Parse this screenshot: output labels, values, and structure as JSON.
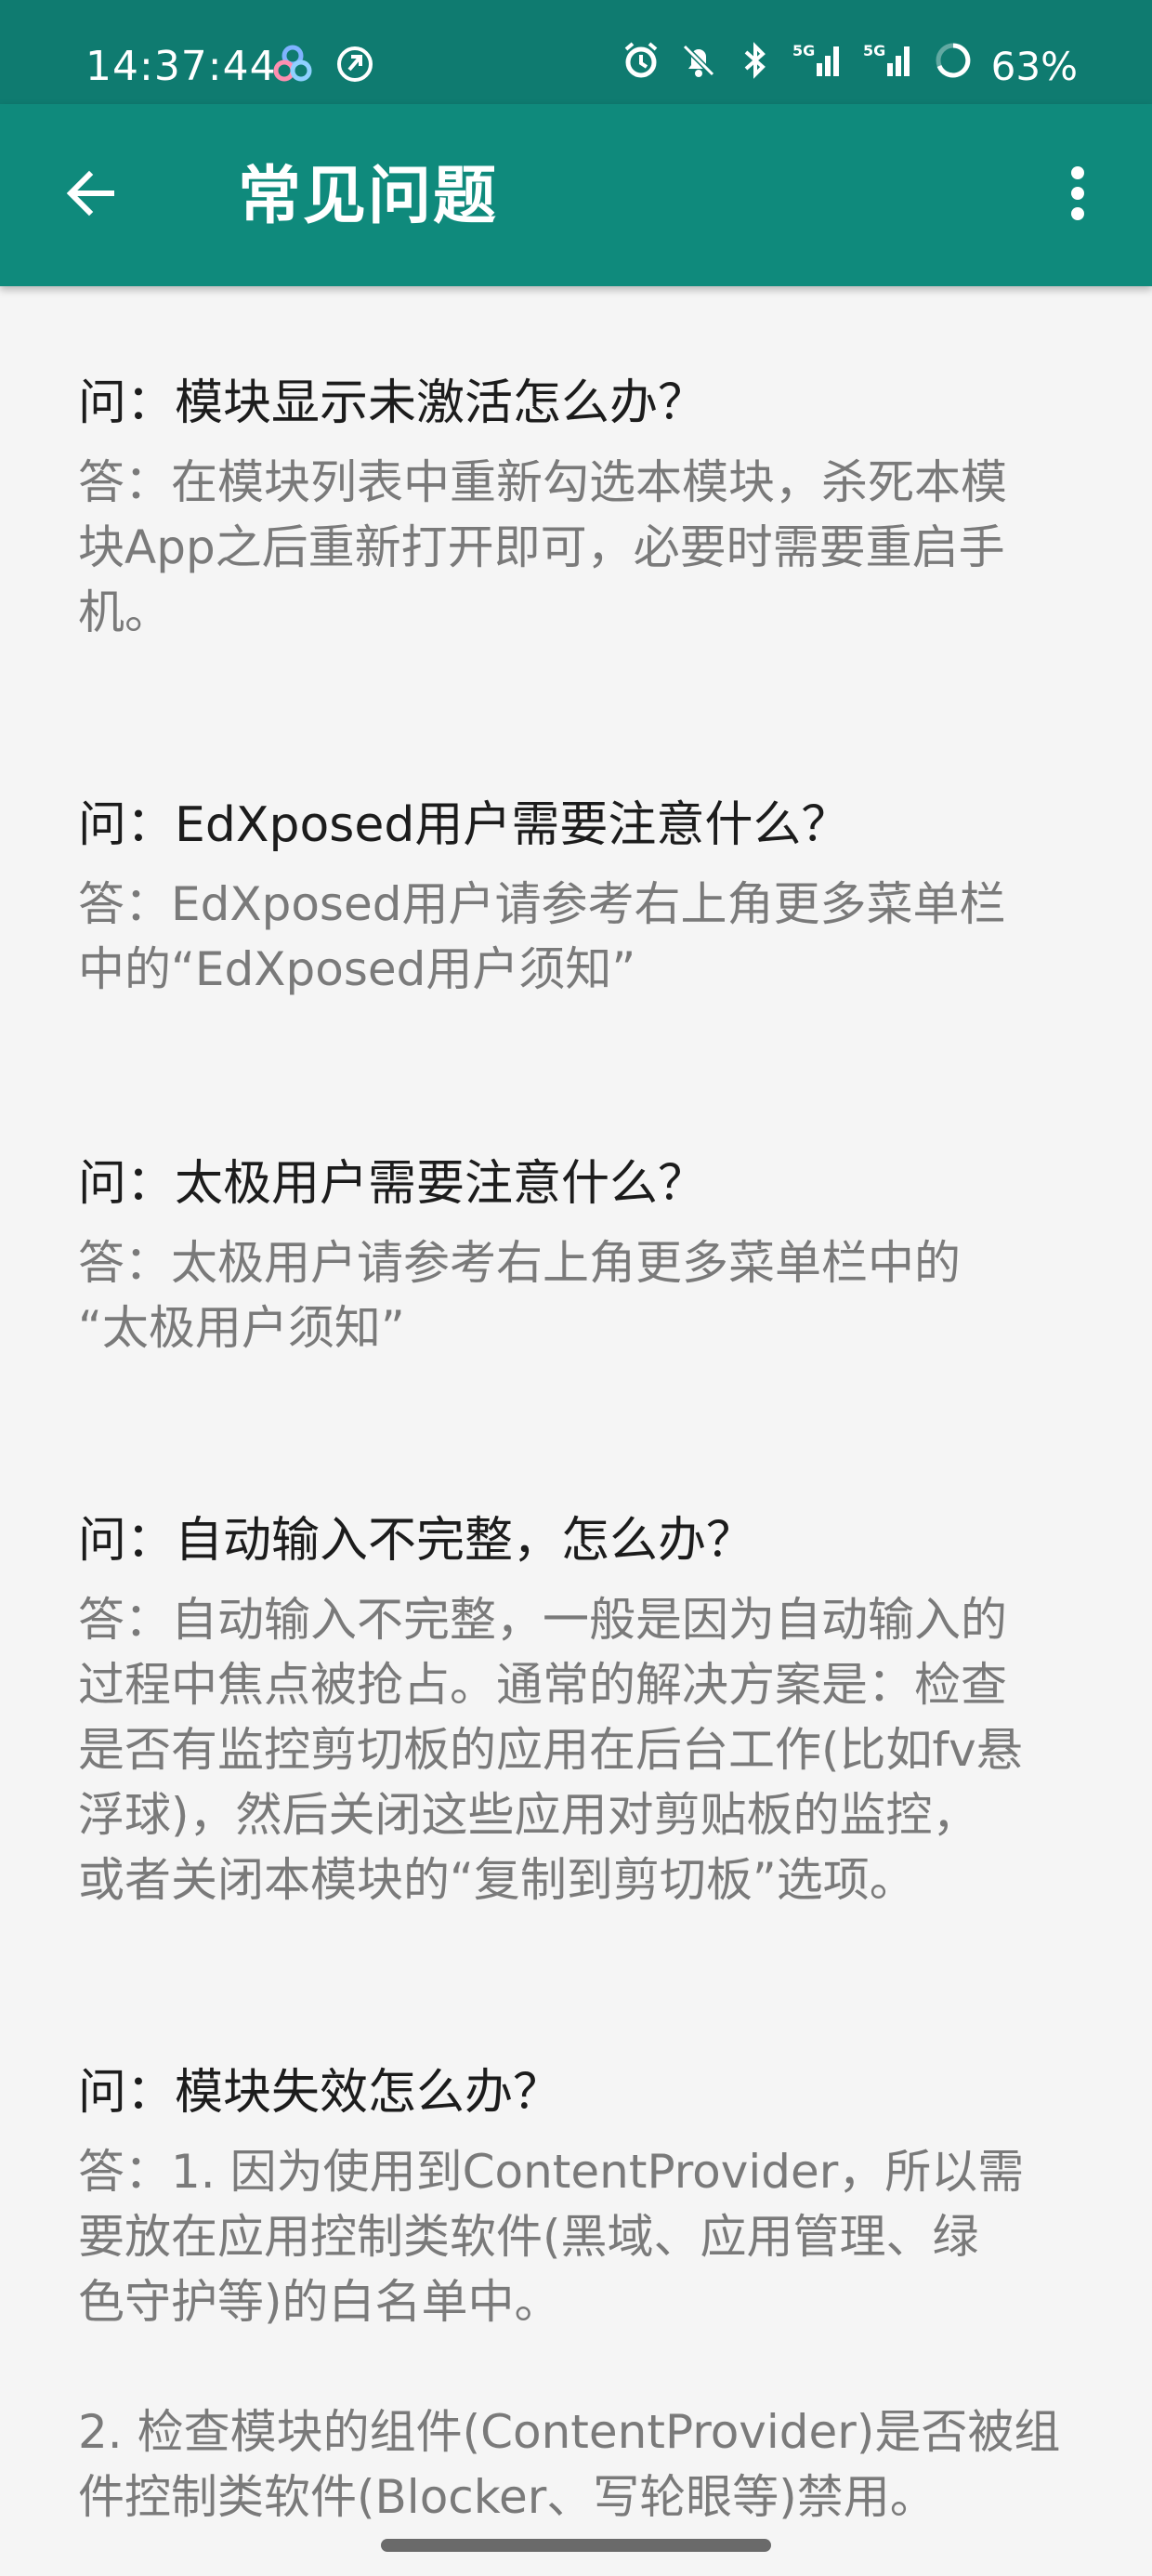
{
  "status_bar": {
    "time": "14:37:44",
    "battery": "63%",
    "signal_labels": [
      "5G",
      "5G"
    ],
    "icons": [
      "multi-color-app-icon",
      "disabled-sync-icon",
      "alarm-icon",
      "notifications-off-icon",
      "bluetooth-icon",
      "signal-5g-icon",
      "signal-5g-icon",
      "battery-ring-icon"
    ]
  },
  "app_bar": {
    "title": "常见问题",
    "back_icon": "arrow-left-icon",
    "menu_icon": "more-vert-icon",
    "color": "#0f8a7c"
  },
  "faq": [
    {
      "question": "问：模块显示未激活怎么办？",
      "answer": "答：在模块列表中重新勾选本模块，杀死本模\n块App之后重新打开即可，必要时需要重启手\n机。"
    },
    {
      "question": "问：EdXposed用户需要注意什么？",
      "answer": "答：EdXposed用户请参考右上角更多菜单栏\n中的“EdXposed用户须知”"
    },
    {
      "question": "问：太极用户需要注意什么？",
      "answer": "答：太极用户请参考右上角更多菜单栏中的\n“太极用户须知”"
    },
    {
      "question": "问：自动输入不完整，怎么办？",
      "answer": "答：自动输入不完整，一般是因为自动输入的\n过程中焦点被抢占。通常的解决方案是：检查\n是否有监控剪切板的应用在后台工作(比如fv悬\n浮球)，然后关闭这些应用对剪贴板的监控，\n或者关闭本模块的“复制到剪切板”选项。"
    },
    {
      "question": "问：模块失效怎么办？",
      "answer": "答：1. 因为使用到ContentProvider，所以需\n要放在应用控制类软件(黑域、应用管理、绿\n色守护等)的白名单中。",
      "answer2": "2. 检查模块的组件(ContentProvider)是否被组\n件控制类软件(Blocker、写轮眼等)禁用。"
    }
  ]
}
